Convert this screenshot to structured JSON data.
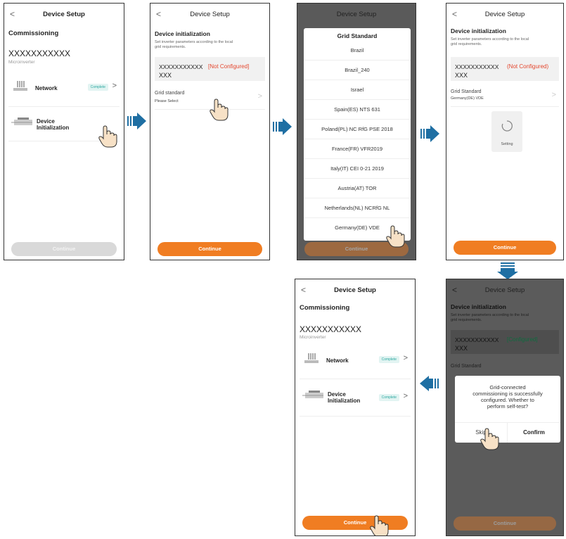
{
  "common": {
    "back": "<",
    "device_setup": "Device Setup",
    "commissioning": "Commissioning",
    "sn": "XXXXXXXXXXX",
    "model": "Microinverter",
    "network": "Network",
    "device_init_l1": "Device",
    "device_init_l2": "Initialization",
    "complete": "Complete",
    "continue": "Continue",
    "chevron": ">"
  },
  "init": {
    "title": "Device initialization",
    "desc_l1": "Set inverter parameters according to the local",
    "desc_l2": "grid requirements.",
    "sn": "XXXXXXXXXXX",
    "not_configured": "[Not Configured]",
    "not_configured_2": "(Not Configured)",
    "configured": "[Configured]",
    "xxx": "XXX",
    "grid_standard": "Grid standard",
    "grid_standard_2": "Grid Standard",
    "please_select": "Please Select",
    "selected_value": "Germany(DE) VDE",
    "setting": "Setting"
  },
  "grid_popup": {
    "title": "Grid Standard",
    "items": [
      "Brazil",
      "Brazil_240",
      "Israel",
      "Spain(ES) NTS 631",
      "Poland(PL) NC RfG PSE 2018",
      "France(FR) VFR2019",
      "Italy(IT) CEI 0-21 2019",
      "Austria(AT) TOR",
      "Netherlands(NL) NCRfG NL",
      "Germany(DE) VDE"
    ]
  },
  "dialog": {
    "line1": "Grid-connected",
    "line2": "commissioning is successfully",
    "line3": "configured. Whether to",
    "line4": "perform self-test?",
    "skip": "Skip",
    "confirm": "Confirm"
  },
  "colors": {
    "accent": "#f07d22",
    "error": "#e4462d",
    "ok": "#2aa7a0",
    "arrow": "#1f6fa3"
  }
}
